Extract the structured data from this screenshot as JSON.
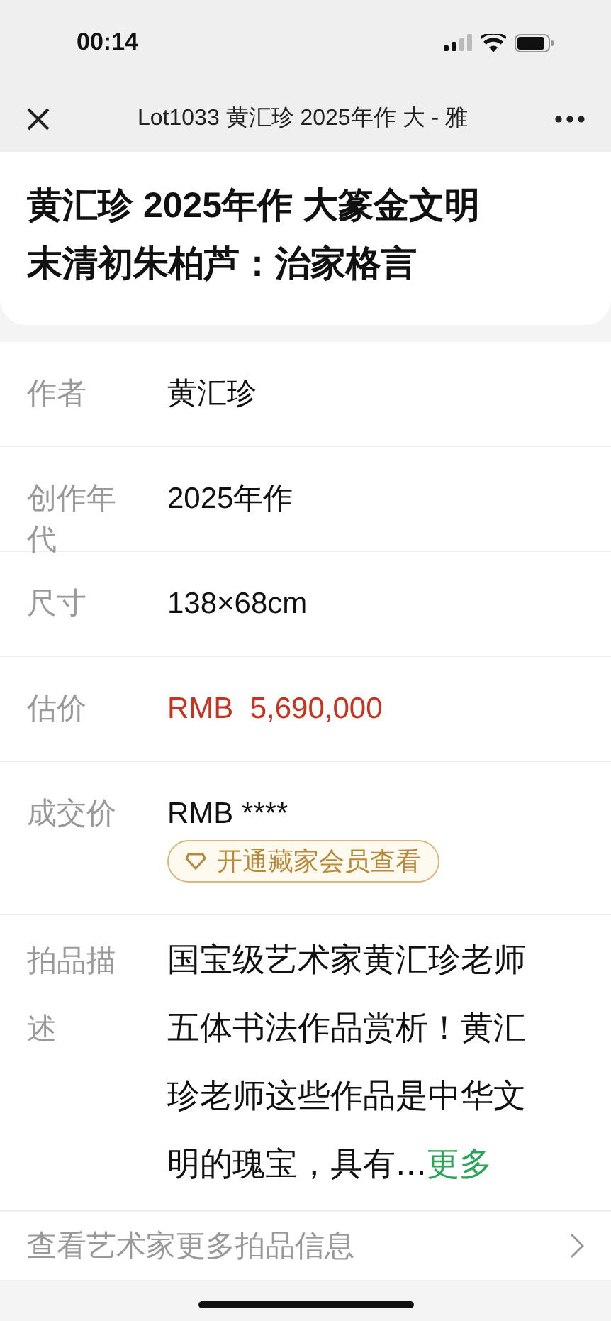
{
  "status_bar": {
    "time": "00:14"
  },
  "nav": {
    "title": "Lot1033 黄汇珍 2025年作 大 - 雅"
  },
  "header": {
    "title": "黄汇珍 2025年作 大篆金文明末清初朱柏芦：治家格言"
  },
  "details": [
    {
      "kind": "text",
      "label": "作者",
      "value": "黄汇珍"
    },
    {
      "kind": "text",
      "label": "创作年代",
      "value": "2025年作"
    },
    {
      "kind": "text",
      "label": "尺寸",
      "value": "138×68cm"
    },
    {
      "kind": "price",
      "label": "估价",
      "currency": "RMB",
      "value": "5,690,000"
    },
    {
      "kind": "hidden",
      "label": "成交价",
      "currency": "RMB",
      "value": "****",
      "button": "开通藏家会员查看"
    },
    {
      "kind": "description",
      "label": "拍品描述",
      "value": "国宝级艺术家黄汇珍老师五体书法作品赏析！黄汇珍老师这些作品是中华文明的瑰宝，具有...",
      "more": "更多"
    }
  ],
  "link_row": {
    "label": "查看艺术家更多拍品信息"
  }
}
